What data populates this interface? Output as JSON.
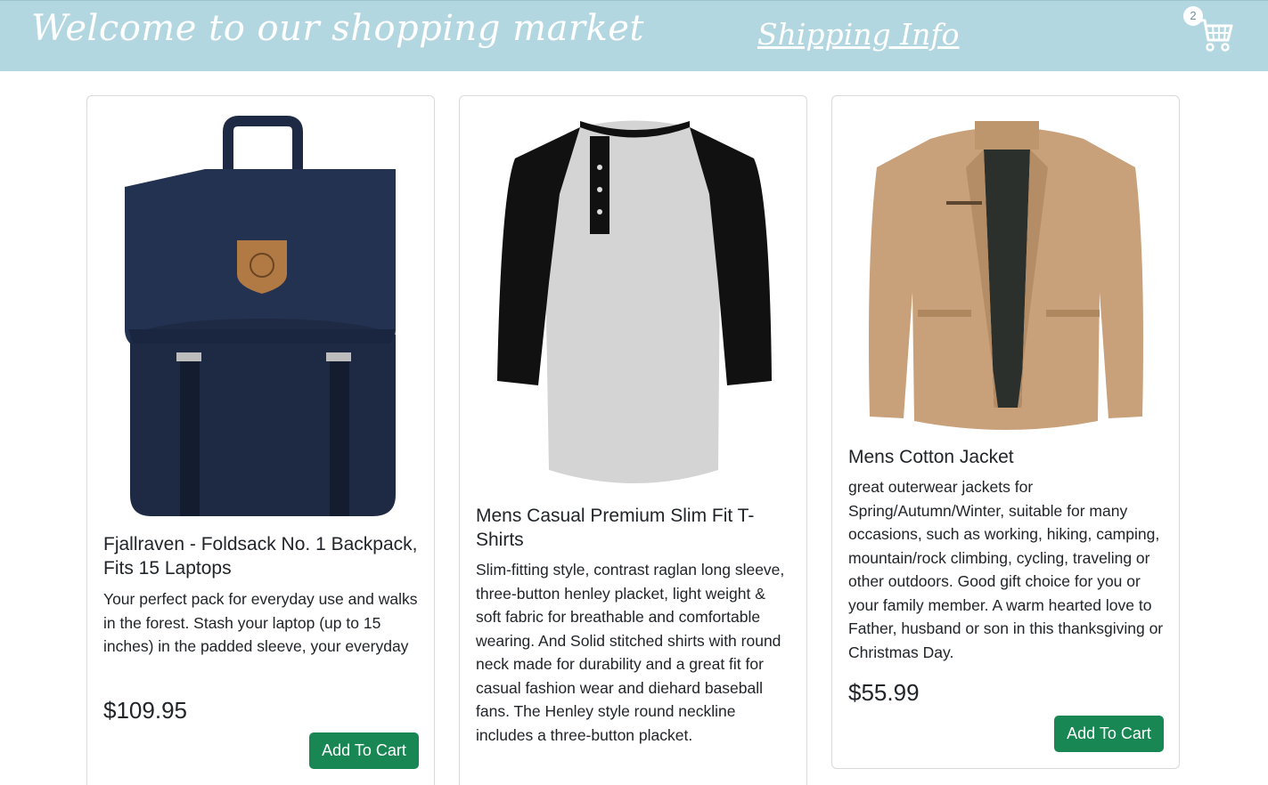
{
  "header": {
    "brand": "Welcome to our shopping market",
    "shipping_link": "Shipping Info",
    "cart_count": "2"
  },
  "products": [
    {
      "title": "Fjallraven - Foldsack No. 1 Backpack, Fits 15 Laptops",
      "description": "Your perfect pack for everyday use and walks in the forest. Stash your laptop (up to 15 inches) in the padded sleeve, your everyday",
      "price": "$109.95",
      "button": "Add To Cart"
    },
    {
      "title": "Mens Casual Premium Slim Fit T-Shirts",
      "description": "Slim-fitting style, contrast raglan long sleeve, three-button henley placket, light weight & soft fabric for breathable and comfortable wearing. And Solid stitched shirts with round neck made for durability and a great fit for casual fashion wear and diehard baseball fans. The Henley style round neckline includes a three-button placket.",
      "price": "",
      "button": ""
    },
    {
      "title": "Mens Cotton Jacket",
      "description": "great outerwear jackets for Spring/Autumn/Winter, suitable for many occasions, such as working, hiking, camping, mountain/rock climbing, cycling, traveling or other outdoors. Good gift choice for you or your family member. A warm hearted love to Father, husband or son in this thanksgiving or Christmas Day.",
      "price": "$55.99",
      "button": "Add To Cart"
    }
  ],
  "colors": {
    "header_bg": "#b3d7e0",
    "button_bg": "#198754",
    "backpack": "#1e2a44",
    "jacket": "#c8a07a"
  }
}
